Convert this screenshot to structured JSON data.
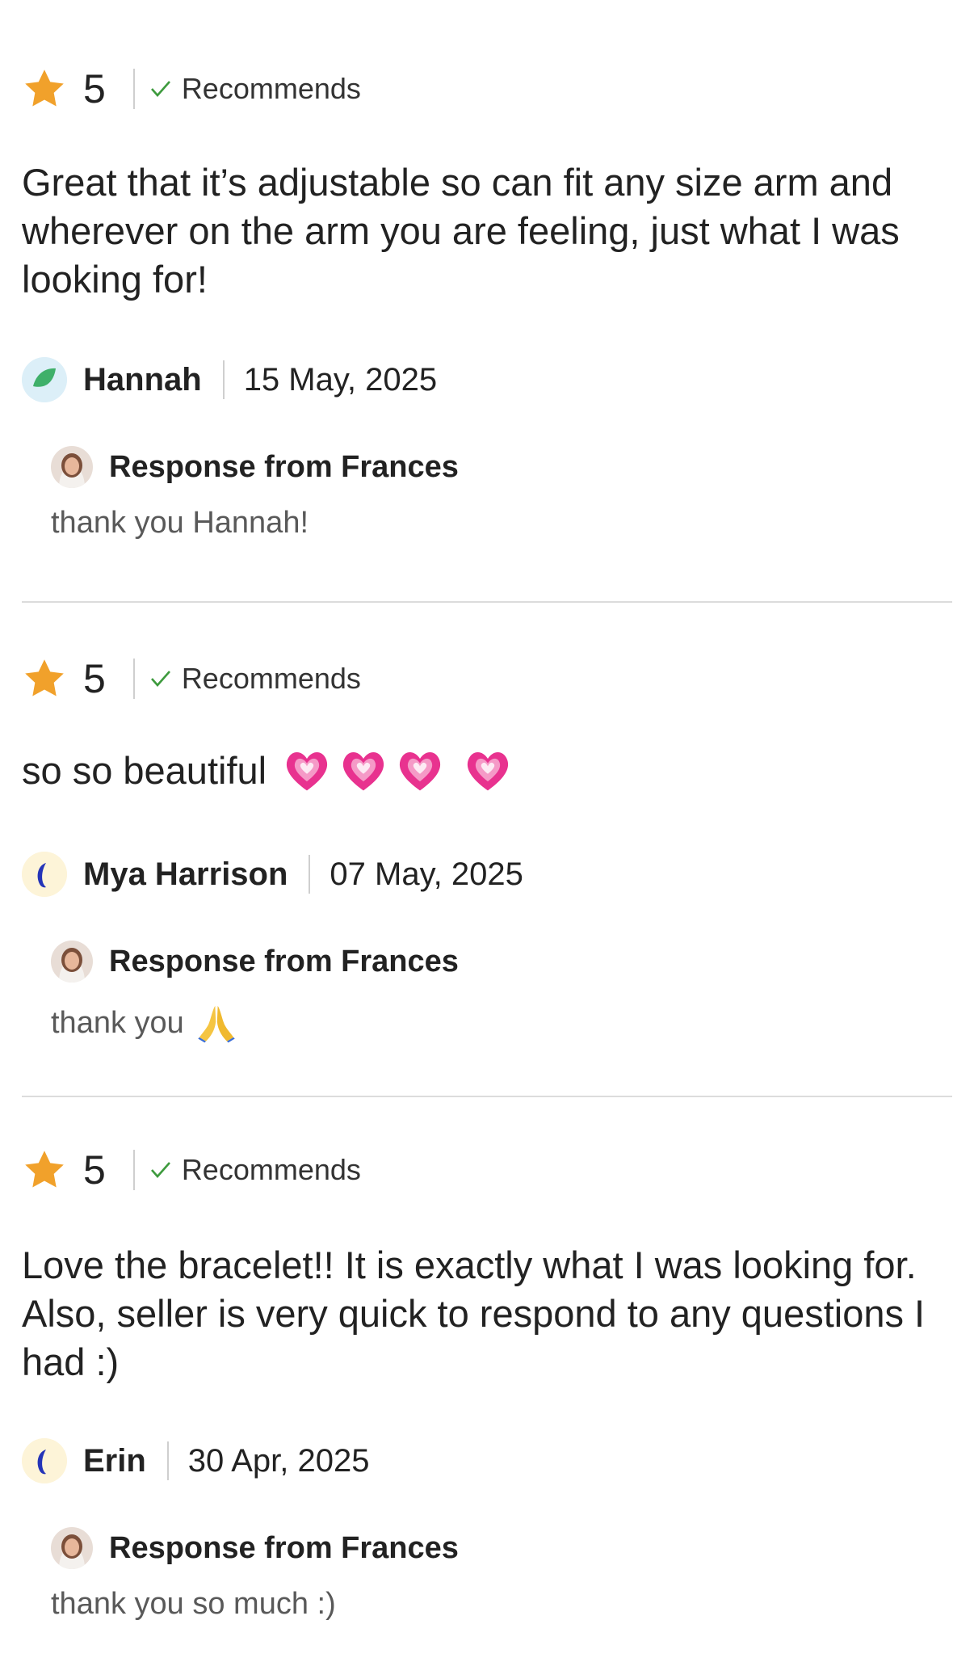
{
  "reviews": [
    {
      "rating": "5",
      "recommends": "Recommends",
      "text": "Great that it’s adjustable so can fit any size arm and wherever on the arm you are feeling, just what I was looking for!",
      "author": "Hannah",
      "date": "15 May, 2025",
      "avatar_icon": "green-leaf-avatar",
      "response_title": "Response from Frances",
      "response_text": "thank you Hannah!"
    },
    {
      "rating": "5",
      "recommends": "Recommends",
      "text": "so so beautiful",
      "text_emojis": [
        "heart-icon",
        "heart-icon",
        "heart-icon",
        "heart-icon"
      ],
      "author": "Mya Harrison",
      "date": "07 May, 2025",
      "avatar_icon": "blue-moon-avatar",
      "response_title": "Response from Frances",
      "response_text": "thank you",
      "response_emoji": "praying-hands-icon"
    },
    {
      "rating": "5",
      "recommends": "Recommends",
      "text": "Love the bracelet!! It is exactly what I was looking for. Also, seller is very quick to respond to any questions I had :)",
      "author": "Erin",
      "date": "30 Apr, 2025",
      "avatar_icon": "blue-moon-avatar",
      "response_title": "Response from Frances",
      "response_text": "thank you so much :)"
    }
  ],
  "colors": {
    "star": "#f1a12b",
    "check": "#3d9a3d",
    "divider": "#dcdcdc",
    "heart": "#e8328f"
  }
}
